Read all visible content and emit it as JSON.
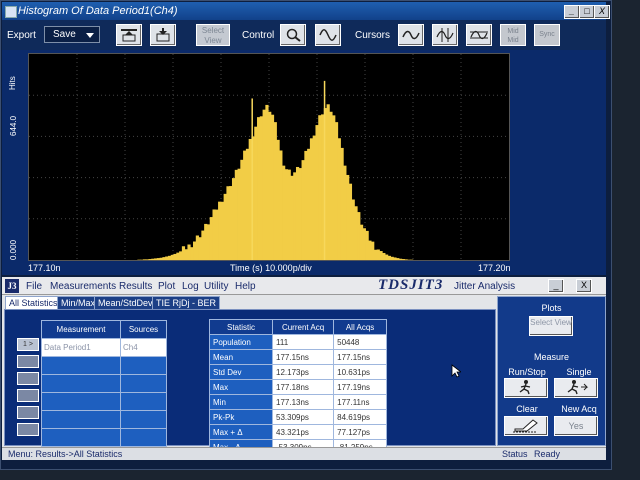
{
  "window": {
    "title": "Histogram Of Data Period1(Ch4)",
    "controls": [
      "_",
      "□",
      "X"
    ]
  },
  "toolbar": {
    "export_label": "Export",
    "save_label": "Save",
    "select_view": "Select View",
    "control_label": "Control",
    "cursors_label": "Cursors",
    "mid_label": "Mid Mid",
    "sync_label": "Sync"
  },
  "plot": {
    "y_axis_label": "Hits",
    "y_max_label": "644.0",
    "y_min_label": "0.000",
    "x_min_label": "177.10n",
    "x_center_label": "Time (s)  10.000p/div",
    "x_max_label": "177.20n"
  },
  "chart_data": {
    "type": "bar",
    "title": "Histogram Of Data Period1(Ch4)",
    "xlabel": "Time (s)",
    "ylabel": "Hits",
    "xlim": [
      177.1,
      177.2
    ],
    "x_units": "ns",
    "ylim": [
      0,
      644
    ],
    "grid": true,
    "note_peaks": [
      177.14,
      177.16
    ],
    "values": [
      0,
      0,
      0,
      1,
      1,
      2,
      2,
      3,
      4,
      5,
      6,
      7,
      9,
      11,
      13,
      16,
      19,
      23,
      27,
      32,
      38,
      44,
      51,
      60,
      70,
      80,
      92,
      104,
      118,
      132,
      147,
      162,
      178,
      193,
      209,
      224,
      240,
      256,
      273,
      292,
      311,
      331,
      352,
      374,
      397,
      419,
      440,
      458,
      470,
      476,
      470,
      452,
      420,
      380,
      338,
      306,
      286,
      276,
      272,
      274,
      282,
      294,
      310,
      330,
      352,
      376,
      400,
      424,
      446,
      464,
      475,
      478,
      470,
      450,
      420,
      385,
      346,
      306,
      268,
      232,
      198,
      168,
      141,
      117,
      97,
      80,
      65,
      53,
      43,
      35,
      28,
      22,
      17,
      13,
      10,
      8,
      6,
      4,
      3,
      2,
      1,
      1,
      0,
      0,
      0,
      0
    ]
  },
  "app": {
    "logo": "J3",
    "menu": [
      "File",
      "Measurements",
      "Results",
      "Plot",
      "Log",
      "Utility",
      "Help"
    ],
    "product": "TDSJIT3",
    "subtitle": "Jitter Analysis",
    "tabs": [
      "All Statistics",
      "Min/Max",
      "Mean/StdDev",
      "TIE RjDj - BER"
    ],
    "row_buttons": [
      "1 >",
      "",
      "",
      "",
      "",
      ""
    ],
    "measurements": {
      "headers": [
        "Measurement",
        "Sources"
      ],
      "rows": [
        {
          "measurement": "Data Period1",
          "source": "Ch4"
        },
        {
          "measurement": "",
          "source": ""
        },
        {
          "measurement": "",
          "source": ""
        },
        {
          "measurement": "",
          "source": ""
        },
        {
          "measurement": "",
          "source": ""
        },
        {
          "measurement": "",
          "source": ""
        }
      ]
    },
    "statistics": {
      "headers": [
        "Statistic",
        "Current Acq",
        "All Acqs"
      ],
      "rows": [
        {
          "name": "Population",
          "current": "111",
          "all": "50448"
        },
        {
          "name": "Mean",
          "current": "177.15ns",
          "all": "177.15ns"
        },
        {
          "name": "Std Dev",
          "current": "12.173ps",
          "all": "10.631ps"
        },
        {
          "name": "Max",
          "current": "177.18ns",
          "all": "177.19ns"
        },
        {
          "name": "Min",
          "current": "177.13ns",
          "all": "177.11ns"
        },
        {
          "name": "Pk-Pk",
          "current": "53.309ps",
          "all": "84.619ps"
        },
        {
          "name": "Max + Δ",
          "current": "43.321ps",
          "all": "77.127ps"
        },
        {
          "name": "Max - Δ",
          "current": "-53.309ps",
          "all": "-81.259ps"
        }
      ]
    },
    "side": {
      "plots_label": "Plots",
      "select_view": "Select View",
      "measure_label": "Measure",
      "run_stop": "Run/Stop",
      "single": "Single",
      "clear": "Clear",
      "new_acq": "New Acq",
      "yes": "Yes"
    },
    "status": {
      "menu_path": "Menu: Results->All Statistics",
      "status_label": "Status",
      "status_value": "Ready"
    }
  }
}
